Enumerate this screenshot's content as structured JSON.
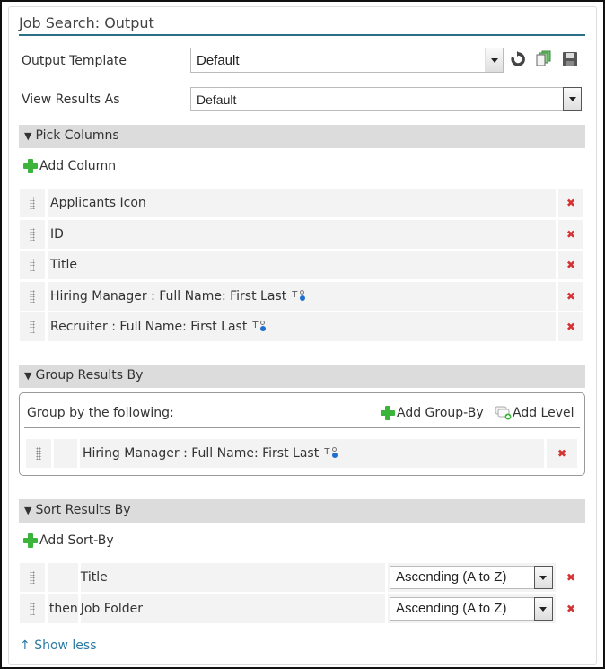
{
  "header": {
    "title": "Job Search: Output"
  },
  "output_template": {
    "label": "Output Template",
    "value": "Default",
    "tools": [
      "reset-icon",
      "copy-icon",
      "save-icon"
    ]
  },
  "view_results": {
    "label": "View Results As",
    "value": "Default"
  },
  "pick_columns": {
    "title": "Pick Columns",
    "add_label": "Add Column",
    "columns": [
      {
        "name": "Applicants Icon",
        "has_field_icon": false
      },
      {
        "name": "ID",
        "has_field_icon": false
      },
      {
        "name": "Title",
        "has_field_icon": false
      },
      {
        "name": "Hiring Manager : Full Name: First Last",
        "has_field_icon": true
      },
      {
        "name": "Recruiter : Full Name: First Last",
        "has_field_icon": true
      }
    ]
  },
  "group_results": {
    "title": "Group Results By",
    "subtitle": "Group by the following:",
    "add_group_label": "Add Group-By",
    "add_level_label": "Add Level",
    "groups": [
      {
        "name": "Hiring Manager : Full Name: First Last",
        "has_field_icon": true
      }
    ]
  },
  "sort_results": {
    "title": "Sort Results By",
    "add_label": "Add Sort-By",
    "sorts": [
      {
        "prefix": "",
        "name": "Title",
        "order": "Ascending (A to Z)"
      },
      {
        "prefix": "then",
        "name": "Job Folder",
        "order": "Ascending (A to Z)"
      }
    ]
  },
  "footer": {
    "show_less_icon": "↑",
    "show_less_label": "Show less"
  },
  "colors": {
    "accent": "#2b6f86",
    "link": "#2b7aa3",
    "delete": "#d63232",
    "add": "#3bb43b",
    "section_bg": "#dcdcdc"
  }
}
